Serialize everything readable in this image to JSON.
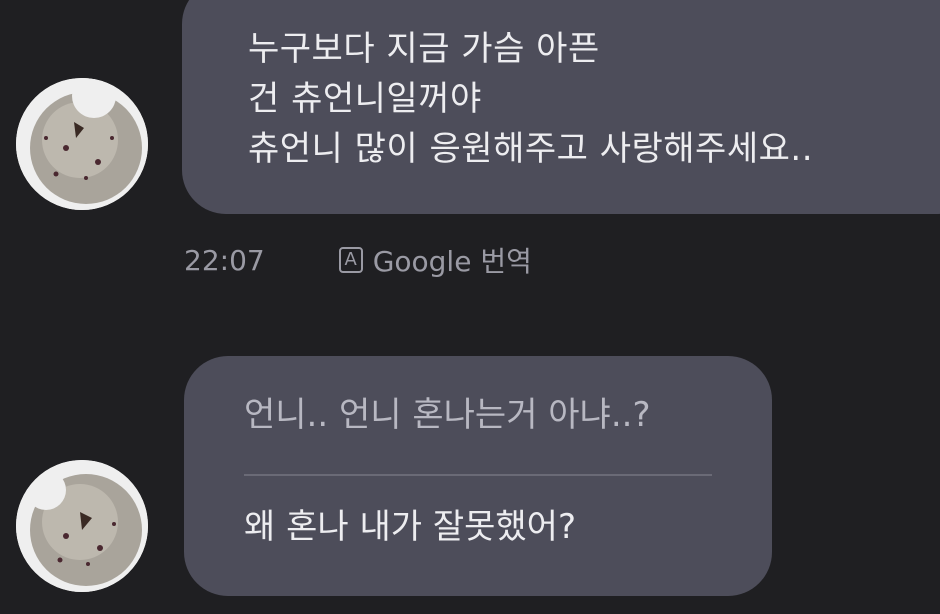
{
  "colors": {
    "background": "#1f1f22",
    "bubble": "#4d4d5a",
    "text": "#ededf0",
    "muted": "#9a9aa4"
  },
  "messages": [
    {
      "avatar_icon": "bagel-avatar-icon",
      "lines": [
        "누구보다 지금 가슴 아픈",
        "건 츄언니일꺼야",
        "츄언니 많이 응원해주고 사랑해주세요.."
      ],
      "time": "22:07",
      "translate_icon_letter": "A",
      "translate_label": "Google 번역"
    },
    {
      "avatar_icon": "bagel-avatar-icon",
      "translated_text": "언니.. 언니 혼나는거 아냐..?",
      "original_text": "왜 혼나 내가 잘못했어?"
    }
  ]
}
